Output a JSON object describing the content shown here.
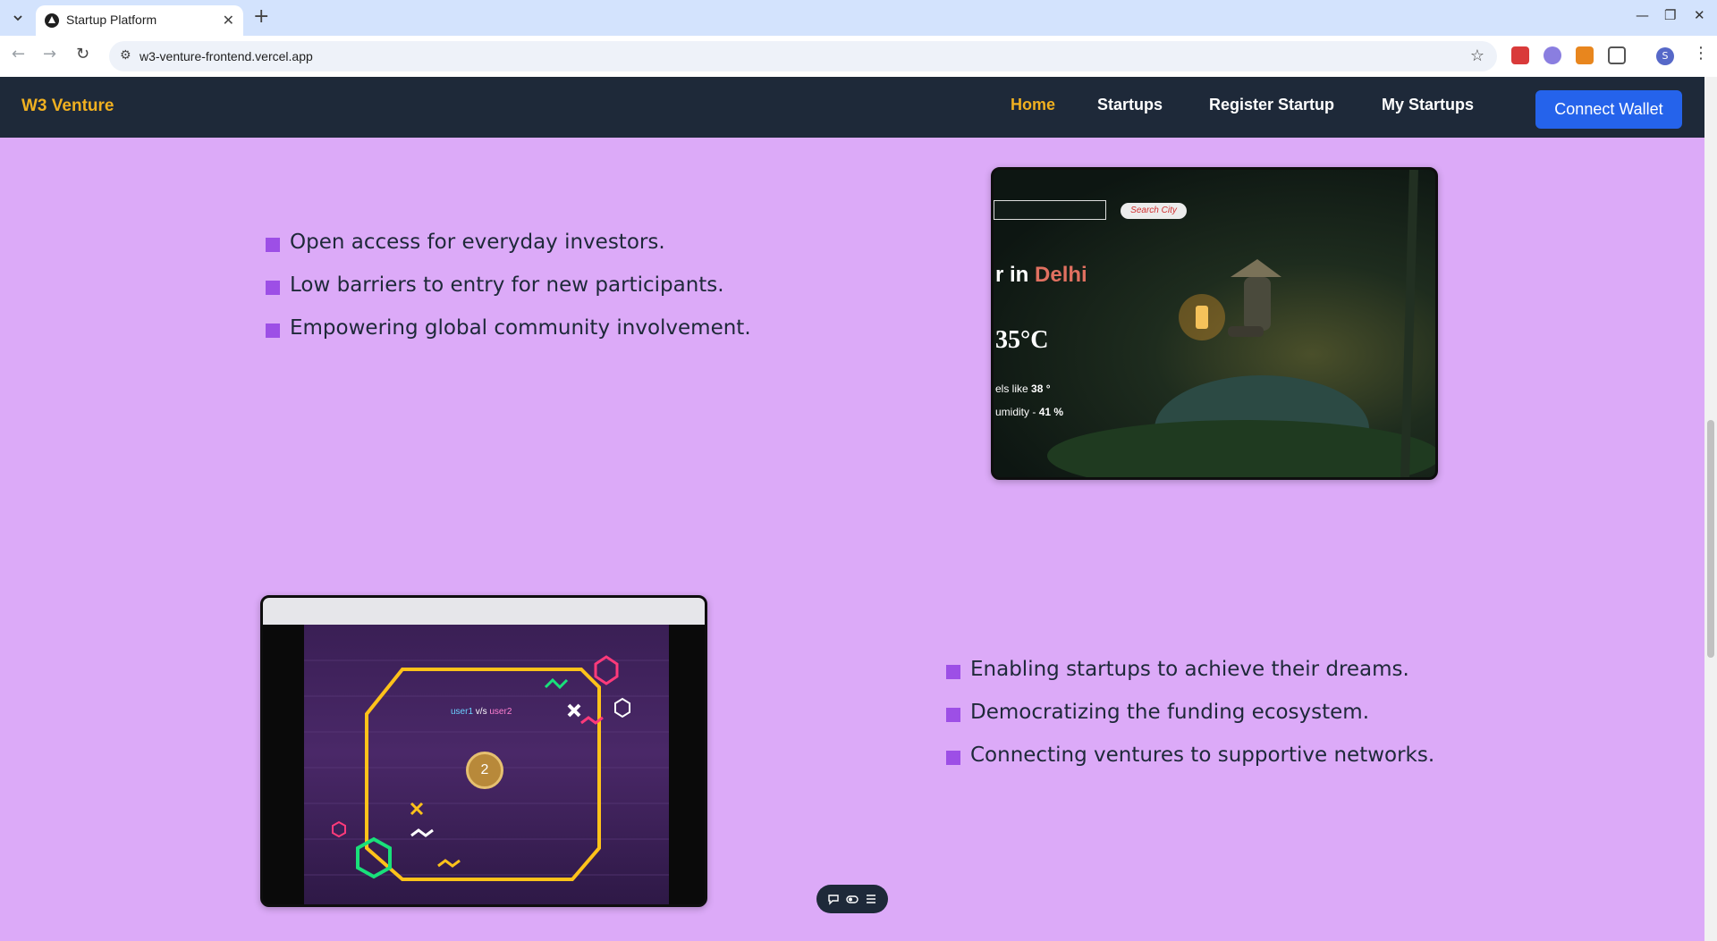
{
  "browser": {
    "tab_title": "Startup Platform",
    "url": "w3-venture-frontend.vercel.app",
    "profile_initial": "S"
  },
  "nav": {
    "brand": "W3 Venture",
    "links": [
      "Home",
      "Startups",
      "Register Startup",
      "My Startups"
    ],
    "active": "Home",
    "connect_label": "Connect Wallet"
  },
  "section1": {
    "items": [
      "Open access for everyday investors.",
      "Low barriers to entry for new participants.",
      "Empowering global community involvement."
    ]
  },
  "section2": {
    "items": [
      "Enabling startups to achieve their dreams.",
      "Democratizing the funding ecosystem.",
      "Connecting ventures to supportive networks."
    ]
  },
  "weather_preview": {
    "search_button": "Search City",
    "title_prefix": "r in ",
    "city": "Delhi",
    "temperature": "35°C",
    "feels_like_label": "els like ",
    "feels_like_value": "38 °",
    "humidity_label": "umidity - ",
    "humidity_value": "41 %"
  },
  "game_preview": {
    "player1": "user1",
    "versus": "v/s",
    "player2": "user2",
    "round": "2"
  },
  "colors": {
    "page_bg": "#dcaaf8",
    "nav_bg": "#1e2939",
    "accent_gold": "#f0b020",
    "button_blue": "#2563eb",
    "bullet_purple": "#9d4fe6"
  }
}
